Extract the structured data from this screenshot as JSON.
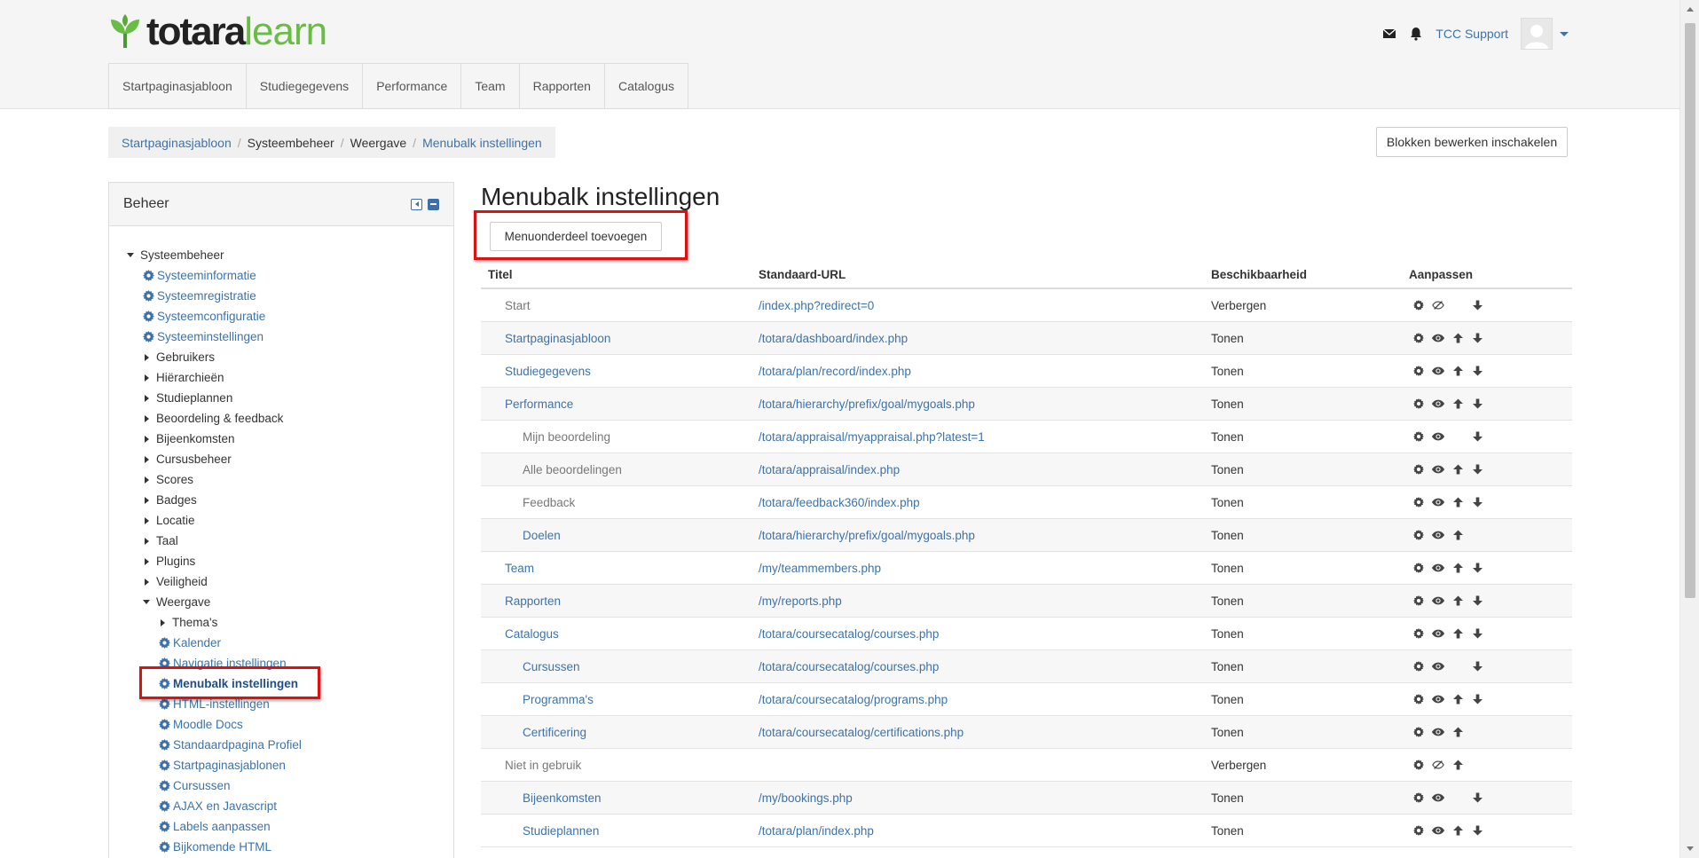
{
  "header": {
    "logo_word1": "totara",
    "logo_word2": "learn",
    "user_name": "TCC Support",
    "nav": [
      "Startpaginasjabloon",
      "Studiegegevens",
      "Performance",
      "Team",
      "Rapporten",
      "Catalogus"
    ]
  },
  "breadcrumb": [
    {
      "label": "Startpaginasjabloon",
      "link": true
    },
    {
      "label": "Systeembeheer",
      "link": false
    },
    {
      "label": "Weergave",
      "link": false
    },
    {
      "label": "Menubalk instellingen",
      "link": true
    }
  ],
  "blocks_button": "Blokken bewerken inschakelen",
  "sidebar": {
    "title": "Beheer",
    "root": "Systeembeheer",
    "items": [
      {
        "label": "Systeeminformatie",
        "kind": "link",
        "level": 1
      },
      {
        "label": "Systeemregistratie",
        "kind": "link",
        "level": 1
      },
      {
        "label": "Systeemconfiguratie",
        "kind": "link",
        "level": 1
      },
      {
        "label": "Systeeminstellingen",
        "kind": "link",
        "level": 1
      },
      {
        "label": "Gebruikers",
        "kind": "cat",
        "level": 1
      },
      {
        "label": "Hiërarchieën",
        "kind": "cat",
        "level": 1
      },
      {
        "label": "Studieplannen",
        "kind": "cat",
        "level": 1
      },
      {
        "label": "Beoordeling & feedback",
        "kind": "cat",
        "level": 1
      },
      {
        "label": "Bijeenkomsten",
        "kind": "cat",
        "level": 1
      },
      {
        "label": "Cursusbeheer",
        "kind": "cat",
        "level": 1
      },
      {
        "label": "Scores",
        "kind": "cat",
        "level": 1
      },
      {
        "label": "Badges",
        "kind": "cat",
        "level": 1
      },
      {
        "label": "Locatie",
        "kind": "cat",
        "level": 1
      },
      {
        "label": "Taal",
        "kind": "cat",
        "level": 1
      },
      {
        "label": "Plugins",
        "kind": "cat",
        "level": 1
      },
      {
        "label": "Veiligheid",
        "kind": "cat",
        "level": 1
      },
      {
        "label": "Weergave",
        "kind": "open",
        "level": 1
      },
      {
        "label": "Thema's",
        "kind": "cat",
        "level": 2
      },
      {
        "label": "Kalender",
        "kind": "link",
        "level": 2
      },
      {
        "label": "Navigatie instellingen",
        "kind": "link",
        "level": 2
      },
      {
        "label": "Menubalk instellingen",
        "kind": "active",
        "level": 2
      },
      {
        "label": "HTML-instellingen",
        "kind": "link",
        "level": 2
      },
      {
        "label": "Moodle Docs",
        "kind": "link",
        "level": 2
      },
      {
        "label": "Standaardpagina Profiel",
        "kind": "link",
        "level": 2
      },
      {
        "label": "Startpaginasjablonen",
        "kind": "link",
        "level": 2
      },
      {
        "label": "Cursussen",
        "kind": "link",
        "level": 2
      },
      {
        "label": "AJAX en Javascript",
        "kind": "link",
        "level": 2
      },
      {
        "label": "Labels aanpassen",
        "kind": "link",
        "level": 2
      },
      {
        "label": "Bijkomende HTML",
        "kind": "link",
        "level": 2
      }
    ]
  },
  "main": {
    "title": "Menubalk instellingen",
    "add_button": "Menuonderdeel toevoegen",
    "columns": [
      "Titel",
      "Standaard-URL",
      "Beschikbaarheid",
      "Aanpassen"
    ],
    "rows": [
      {
        "title": "Start",
        "url": "/index.php?redirect=0",
        "availability": "Verbergen",
        "sub": false,
        "style": "dim",
        "actions": [
          "edit",
          "hidden",
          "",
          "down"
        ]
      },
      {
        "title": "Startpaginasjabloon",
        "url": "/totara/dashboard/index.php",
        "availability": "Tonen",
        "sub": false,
        "style": "lnk",
        "actions": [
          "edit",
          "show",
          "up",
          "down"
        ]
      },
      {
        "title": "Studiegegevens",
        "url": "/totara/plan/record/index.php",
        "availability": "Tonen",
        "sub": false,
        "style": "lnk",
        "actions": [
          "edit",
          "show",
          "up",
          "down"
        ]
      },
      {
        "title": "Performance",
        "url": "/totara/hierarchy/prefix/goal/mygoals.php",
        "availability": "Tonen",
        "sub": false,
        "style": "lnk",
        "actions": [
          "edit",
          "show",
          "up",
          "down"
        ]
      },
      {
        "title": "Mijn beoordeling",
        "url": "/totara/appraisal/myappraisal.php?latest=1",
        "availability": "Tonen",
        "sub": true,
        "style": "dim",
        "actions": [
          "edit",
          "show",
          "",
          "down"
        ]
      },
      {
        "title": "Alle beoordelingen",
        "url": "/totara/appraisal/index.php",
        "availability": "Tonen",
        "sub": true,
        "style": "dim",
        "actions": [
          "edit",
          "show",
          "up",
          "down"
        ]
      },
      {
        "title": "Feedback",
        "url": "/totara/feedback360/index.php",
        "availability": "Tonen",
        "sub": true,
        "style": "dim",
        "actions": [
          "edit",
          "show",
          "up",
          "down"
        ]
      },
      {
        "title": "Doelen",
        "url": "/totara/hierarchy/prefix/goal/mygoals.php",
        "availability": "Tonen",
        "sub": true,
        "style": "lnk",
        "actions": [
          "edit",
          "show",
          "up",
          ""
        ]
      },
      {
        "title": "Team",
        "url": "/my/teammembers.php",
        "availability": "Tonen",
        "sub": false,
        "style": "lnk",
        "actions": [
          "edit",
          "show",
          "up",
          "down"
        ]
      },
      {
        "title": "Rapporten",
        "url": "/my/reports.php",
        "availability": "Tonen",
        "sub": false,
        "style": "lnk",
        "actions": [
          "edit",
          "show",
          "up",
          "down"
        ]
      },
      {
        "title": "Catalogus",
        "url": "/totara/coursecatalog/courses.php",
        "availability": "Tonen",
        "sub": false,
        "style": "lnk",
        "actions": [
          "edit",
          "show",
          "up",
          "down"
        ]
      },
      {
        "title": "Cursussen",
        "url": "/totara/coursecatalog/courses.php",
        "availability": "Tonen",
        "sub": true,
        "style": "lnk",
        "actions": [
          "edit",
          "show",
          "",
          "down"
        ]
      },
      {
        "title": "Programma's",
        "url": "/totara/coursecatalog/programs.php",
        "availability": "Tonen",
        "sub": true,
        "style": "lnk",
        "actions": [
          "edit",
          "show",
          "up",
          "down"
        ]
      },
      {
        "title": "Certificering",
        "url": "/totara/coursecatalog/certifications.php",
        "availability": "Tonen",
        "sub": true,
        "style": "lnk",
        "actions": [
          "edit",
          "show",
          "up",
          ""
        ]
      },
      {
        "title": "Niet in gebruik",
        "url": "",
        "availability": "Verbergen",
        "sub": false,
        "style": "dim",
        "actions": [
          "edit",
          "hidden",
          "up",
          ""
        ]
      },
      {
        "title": "Bijeenkomsten",
        "url": "/my/bookings.php",
        "availability": "Tonen",
        "sub": true,
        "style": "lnk",
        "actions": [
          "edit",
          "show",
          "",
          "down"
        ]
      },
      {
        "title": "Studieplannen",
        "url": "/totara/plan/index.php",
        "availability": "Tonen",
        "sub": true,
        "style": "lnk",
        "actions": [
          "edit",
          "show",
          "up",
          "down"
        ]
      }
    ]
  },
  "colors": {
    "link": "#3d73a9",
    "brand_green": "#69bd45",
    "highlight_red": "#dd1111"
  }
}
